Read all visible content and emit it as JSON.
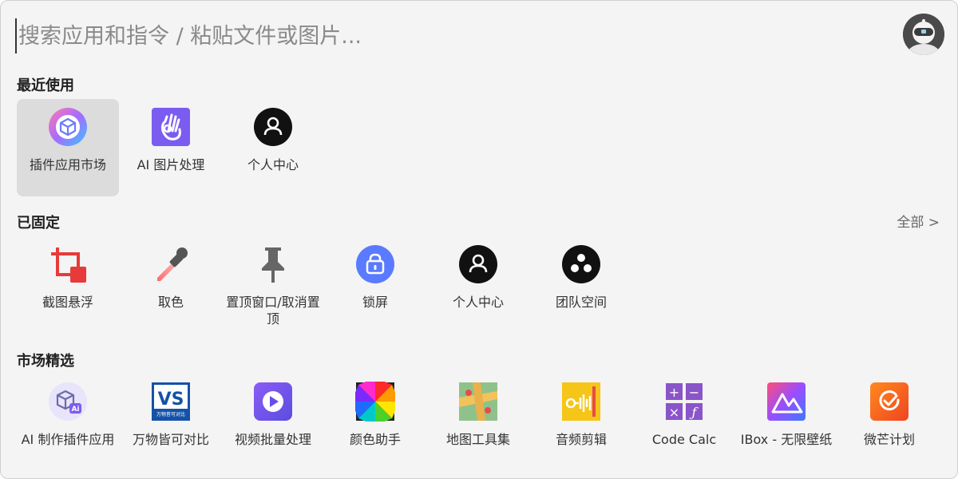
{
  "search": {
    "placeholder": "搜索应用和指令 / 粘贴文件或图片..."
  },
  "sections": {
    "recent": {
      "title": "最近使用"
    },
    "pinned": {
      "title": "已固定",
      "see_all": "全部 >"
    },
    "market": {
      "title": "市场精选"
    }
  },
  "recent_items": [
    {
      "label": "插件应用市场",
      "icon": "plugin-market-icon",
      "selected": true
    },
    {
      "label": "AI 图片处理",
      "icon": "ok-hand-icon"
    },
    {
      "label": "个人中心",
      "icon": "user-icon"
    }
  ],
  "pinned_items": [
    {
      "label": "截图悬浮",
      "icon": "crop-icon"
    },
    {
      "label": "取色",
      "icon": "eyedropper-icon"
    },
    {
      "label": "置顶窗口/取消置顶",
      "icon": "pin-icon"
    },
    {
      "label": "锁屏",
      "icon": "lock-icon"
    },
    {
      "label": "个人中心",
      "icon": "user-icon"
    },
    {
      "label": "团队空间",
      "icon": "team-icon"
    }
  ],
  "market_items": [
    {
      "label": "AI 制作插件应用",
      "icon": "ai-cube-icon"
    },
    {
      "label": "万物皆可对比",
      "icon": "vs-icon",
      "icon_text": "VS",
      "icon_subtext": "万物皆可对比"
    },
    {
      "label": "视频批量处理",
      "icon": "video-play-icon"
    },
    {
      "label": "颜色助手",
      "icon": "color-wheel-icon"
    },
    {
      "label": "地图工具集",
      "icon": "map-icon"
    },
    {
      "label": "音频剪辑",
      "icon": "audio-icon"
    },
    {
      "label": "Code Calc",
      "icon": "calculator-icon",
      "icon_glyphs": [
        "+",
        "−",
        "×",
        "ƒ"
      ]
    },
    {
      "label": "IBox - 无限壁纸",
      "icon": "wallpaper-icon"
    },
    {
      "label": "微芒计划",
      "icon": "check-circle-icon"
    }
  ],
  "colors": {
    "background": "#f4f4f4",
    "selected": "#dcdcdc",
    "ai_purple": "#7b5cf0",
    "crop_red": "#e83a3a",
    "vs_blue": "#1452a8",
    "calc_purple": "#8a55c8",
    "orange": "#f06a1f"
  }
}
